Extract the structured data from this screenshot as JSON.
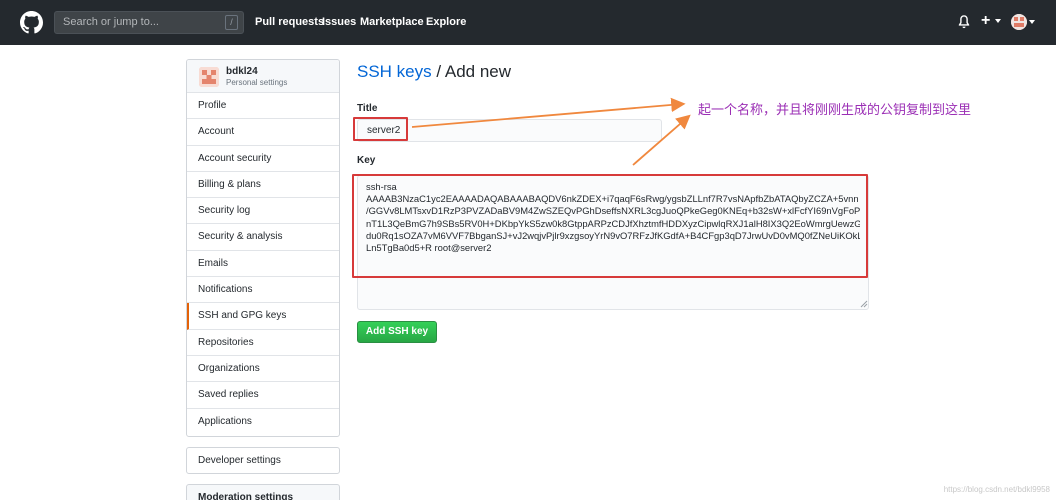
{
  "header": {
    "search_placeholder": "Search or jump to...",
    "search_shortcut": "/",
    "nav": [
      "Pull requests",
      "Issues",
      "Marketplace",
      "Explore"
    ],
    "plus_label": "+"
  },
  "sidebar": {
    "username": "bdkl24",
    "subtitle": "Personal settings",
    "items": [
      {
        "label": "Profile"
      },
      {
        "label": "Account"
      },
      {
        "label": "Account security"
      },
      {
        "label": "Billing & plans"
      },
      {
        "label": "Security log"
      },
      {
        "label": "Security & analysis"
      },
      {
        "label": "Emails"
      },
      {
        "label": "Notifications"
      },
      {
        "label": "SSH and GPG keys"
      },
      {
        "label": "Repositories"
      },
      {
        "label": "Organizations"
      },
      {
        "label": "Saved replies"
      },
      {
        "label": "Applications"
      }
    ],
    "active_index": 8,
    "developer_settings": "Developer settings",
    "moderation_settings": "Moderation settings"
  },
  "main": {
    "title_link": "SSH keys",
    "title_rest": " / Add new",
    "title_label": "Title",
    "title_value": "server2",
    "key_label": "Key",
    "key_lines": [
      "ssh-rsa",
      "AAAAB3NzaC1yc2EAAAADAQABAAABAQDV6nkZDEX+i7qaqF6sRwg/ygsbZLLnf7R7vsNApfbZbATAQbyZCZA+5vnn",
      "/GGVv8LMTsxvD1RzP3PVZADaBV9M4ZwSZEQvPGhDseffsNXRL3cgJuoQPkeGeg0KNEq+b32sW+xlFcfYI69nVgFoPq",
      "nT1L3QeBmG7h9SBs5RV0H+DKbpYkS5zw0k8GtppARPzCDJfXhztmfHDDXyzCipwlqRXJ1alH8IX3Q2EoWmrgUewzG",
      "du0Rq1sOZA7vM6VVF7BbganSJ+vJ2wqjvPjlr9xzgsoyYrN9vO7RFzJfKGdfA+B4CFgp3qD7JrwUvD0vMQ0fZNeUiKOkL",
      "Ln5TgBa0d5+R root@server2"
    ],
    "add_button": "Add SSH key"
  },
  "annotation": "起一个名称，并且将刚刚生成的公钥复制到这里",
  "watermark": "https://blog.csdn.net/bdkl9958",
  "colors": {
    "header_bg": "#24292e",
    "link": "#0366d6",
    "button_green": "#28a745",
    "highlight_red": "#d73a3a",
    "arrow_orange": "#f0883e",
    "annotation_purple": "#9b2fb5",
    "active_marker": "#e36209"
  }
}
